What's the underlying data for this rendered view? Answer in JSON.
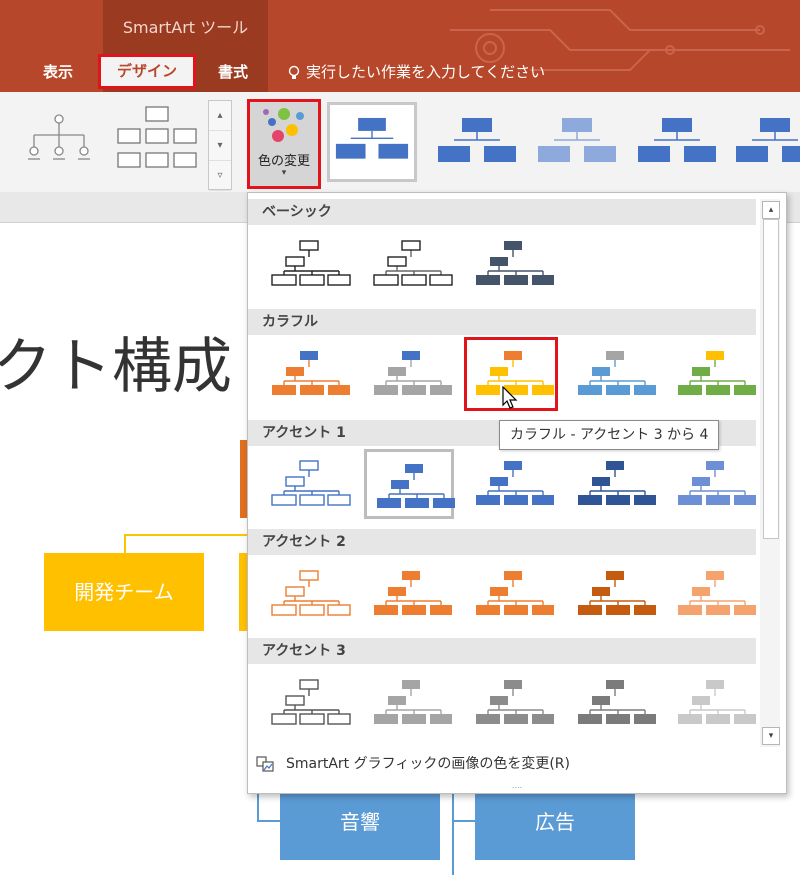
{
  "titlebar": {
    "context_label": "SmartArt ツール",
    "tabs": [
      {
        "label": "表示"
      },
      {
        "label": "デザイン"
      },
      {
        "label": "書式"
      }
    ],
    "tell_me": "実行したい作業を入力してください"
  },
  "ribbon": {
    "change_colors_label": "色の変更",
    "change_colors_caret": "▾",
    "scroll_up": "▴",
    "scroll_down": "▾",
    "scroll_more": "▿"
  },
  "slide": {
    "title_fragment": "クト構成",
    "boxes": {
      "dev_team": "開発チーム",
      "sound": "音響",
      "ad": "広告"
    }
  },
  "gallery": {
    "sections": [
      {
        "label": "ベーシック"
      },
      {
        "label": "カラフル"
      },
      {
        "label": "アクセント 1"
      },
      {
        "label": "アクセント 2"
      },
      {
        "label": "アクセント 3"
      }
    ],
    "tooltip": "カラフル - アクセント 3 から 4",
    "footer_command": "SmartArt グラフィックの画像の色を変更(R)",
    "grip": "....",
    "scroll_up": "▴",
    "scroll_down": "▾"
  },
  "colors": {
    "ribbon_red": "#b7472a",
    "highlight_red": "#e1141c",
    "accent1_blue": "#4472c4",
    "accent2_orange": "#ed7d31",
    "accent3_gray": "#a5a5a5",
    "accent4_gold": "#ffc000",
    "accent5_lightblue": "#5b9bd5",
    "accent6_green": "#70ad47",
    "dark_blue": "#44546a"
  }
}
